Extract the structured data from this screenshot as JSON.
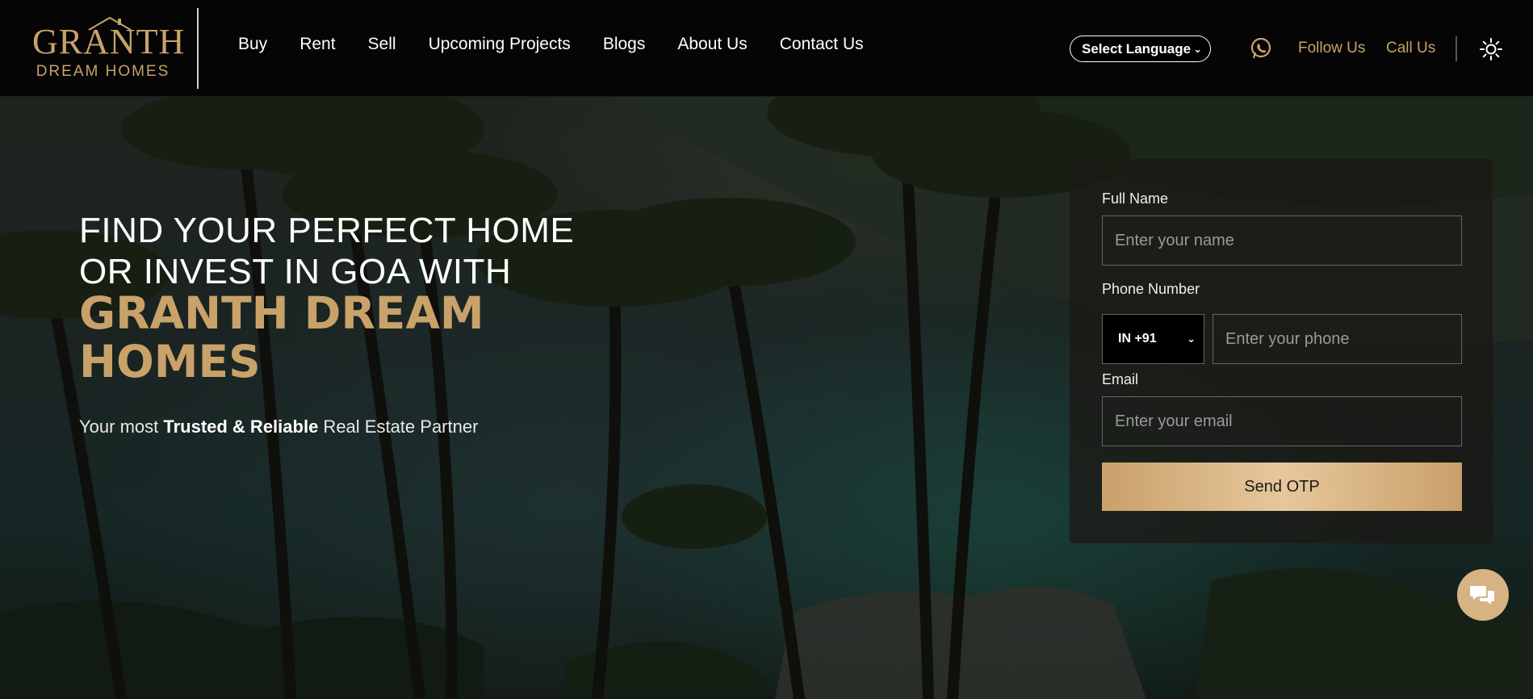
{
  "brand": {
    "logo_top": "GRANTH",
    "logo_bottom": "DREAM HOMES",
    "accent_color": "#c9a26a"
  },
  "nav": {
    "items": [
      {
        "label": "Buy"
      },
      {
        "label": "Rent"
      },
      {
        "label": "Sell"
      },
      {
        "label": "Upcoming Projects"
      },
      {
        "label": "Blogs"
      },
      {
        "label": "About Us"
      },
      {
        "label": "Contact Us"
      }
    ]
  },
  "header": {
    "language_select": "Select Language",
    "whatsapp_icon": "whatsapp-icon",
    "follow_us": "Follow Us",
    "call_us": "Call Us",
    "theme_icon": "sun-icon"
  },
  "hero": {
    "headline_line1": "FIND YOUR PERFECT HOME",
    "headline_line2": "OR INVEST IN GOA WITH",
    "brand_line1": "GRANTH DREAM",
    "brand_line2": "HOMES",
    "tagline_pre": "Your most ",
    "tagline_bold": "Trusted & Reliable",
    "tagline_post": " Real Estate Partner"
  },
  "form": {
    "name_label": "Full Name",
    "name_placeholder": "Enter your name",
    "phone_label": "Phone Number",
    "country_code": "IN +91",
    "phone_placeholder": "Enter your phone",
    "email_label": "Email",
    "email_placeholder": "Enter your email",
    "submit_label": "Send OTP"
  },
  "chat": {
    "icon": "chat-icon"
  }
}
